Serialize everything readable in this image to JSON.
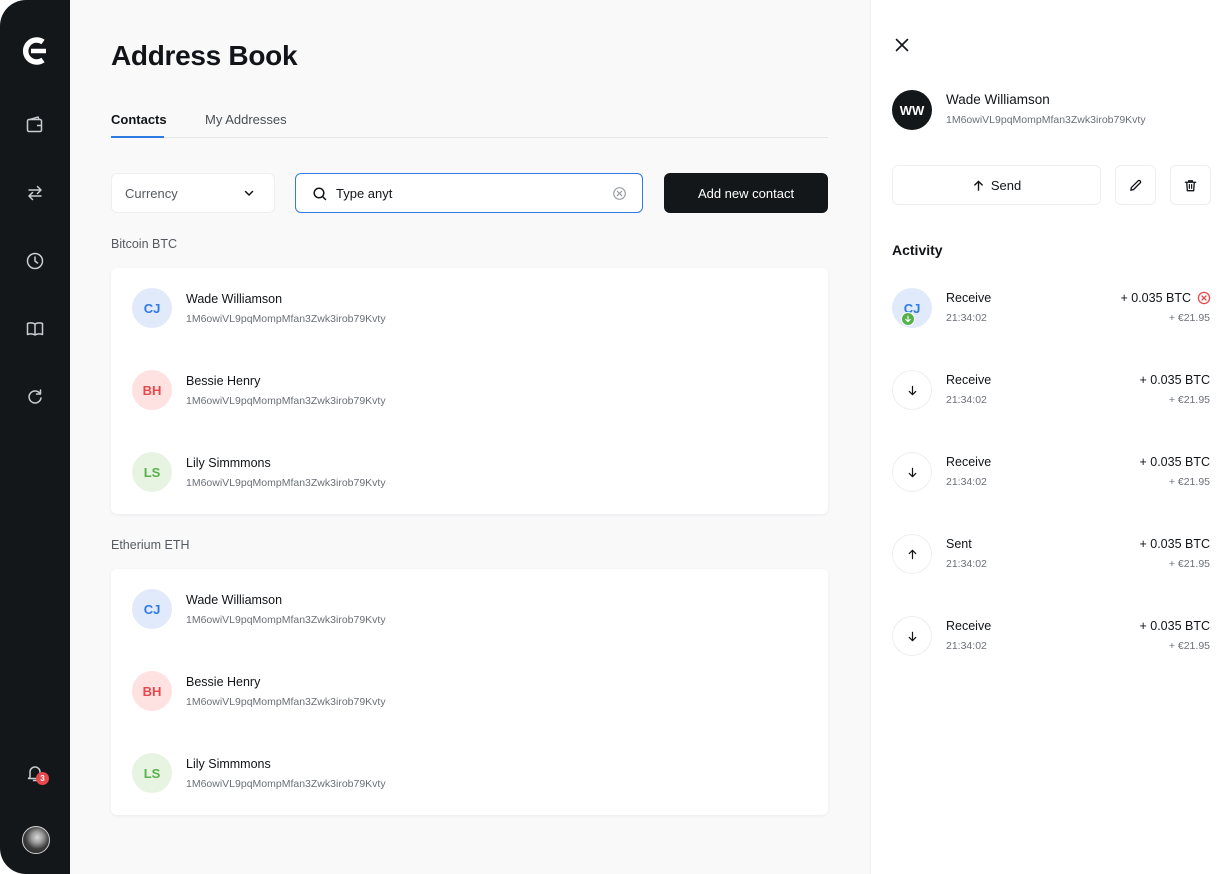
{
  "page_title": "Address Book",
  "tabs": [
    {
      "label": "Contacts",
      "active": true
    },
    {
      "label": "My Addresses",
      "active": false
    }
  ],
  "filters": {
    "currency_label": "Currency",
    "search_value": "Type anyt",
    "add_button": "Add new contact"
  },
  "sections": [
    {
      "label": "Bitcoin BTC",
      "contacts": [
        {
          "initials": "CJ",
          "name": "Wade Williamson",
          "address": "1M6owiVL9pqMompMfan3Zwk3irob79Kvty",
          "color": "blue"
        },
        {
          "initials": "BH",
          "name": "Bessie Henry",
          "address": "1M6owiVL9pqMompMfan3Zwk3irob79Kvty",
          "color": "red"
        },
        {
          "initials": "LS",
          "name": "Lily Simmmons",
          "address": "1M6owiVL9pqMompMfan3Zwk3irob79Kvty",
          "color": "green"
        }
      ]
    },
    {
      "label": "Etherium ETH",
      "contacts": [
        {
          "initials": "CJ",
          "name": "Wade Williamson",
          "address": "1M6owiVL9pqMompMfan3Zwk3irob79Kvty",
          "color": "blue"
        },
        {
          "initials": "BH",
          "name": "Bessie Henry",
          "address": "1M6owiVL9pqMompMfan3Zwk3irob79Kvty",
          "color": "red"
        },
        {
          "initials": "LS",
          "name": "Lily Simmmons",
          "address": "1M6owiVL9pqMompMfan3Zwk3irob79Kvty",
          "color": "green"
        }
      ]
    }
  ],
  "sidebar": {
    "notification_count": "3",
    "icons": [
      "logo-icon",
      "wallet-icon",
      "exchange-icon",
      "history-icon",
      "address-book-icon",
      "refresh-icon",
      "bell-icon"
    ]
  },
  "panel": {
    "initials": "WW",
    "name": "Wade Williamson",
    "address": "1M6owiVL9pqMompMfan3Zwk3irob79Kvty",
    "send_label": "Send",
    "activity_title": "Activity",
    "activity": [
      {
        "type": "Receive",
        "time": "21:34:02",
        "amount": "+ 0.035 BTC",
        "fiat": "+ €21.95",
        "icon": "CJ",
        "status": "error"
      },
      {
        "type": "Receive",
        "time": "21:34:02",
        "amount": "+ 0.035 BTC",
        "fiat": "+ €21.95",
        "icon": "arrow-down"
      },
      {
        "type": "Receive",
        "time": "21:34:02",
        "amount": "+ 0.035 BTC",
        "fiat": "+ €21.95",
        "icon": "arrow-down"
      },
      {
        "type": "Sent",
        "time": "21:34:02",
        "amount": "+ 0.035 BTC",
        "fiat": "+ €21.95",
        "icon": "arrow-up"
      },
      {
        "type": "Receive",
        "time": "21:34:02",
        "amount": "+ 0.035 BTC",
        "fiat": "+ €21.95",
        "icon": "arrow-down"
      }
    ]
  },
  "colors": {
    "accent": "#2f7ae5",
    "dark": "#14171a",
    "avatar_blue_bg": "#e1eafb",
    "avatar_blue_fg": "#2f7ae5",
    "avatar_red_bg": "#fde2e1",
    "avatar_red_fg": "#e5484d",
    "avatar_green_bg": "#e7f4e2",
    "avatar_green_fg": "#56b14a",
    "error": "#e5484d"
  }
}
